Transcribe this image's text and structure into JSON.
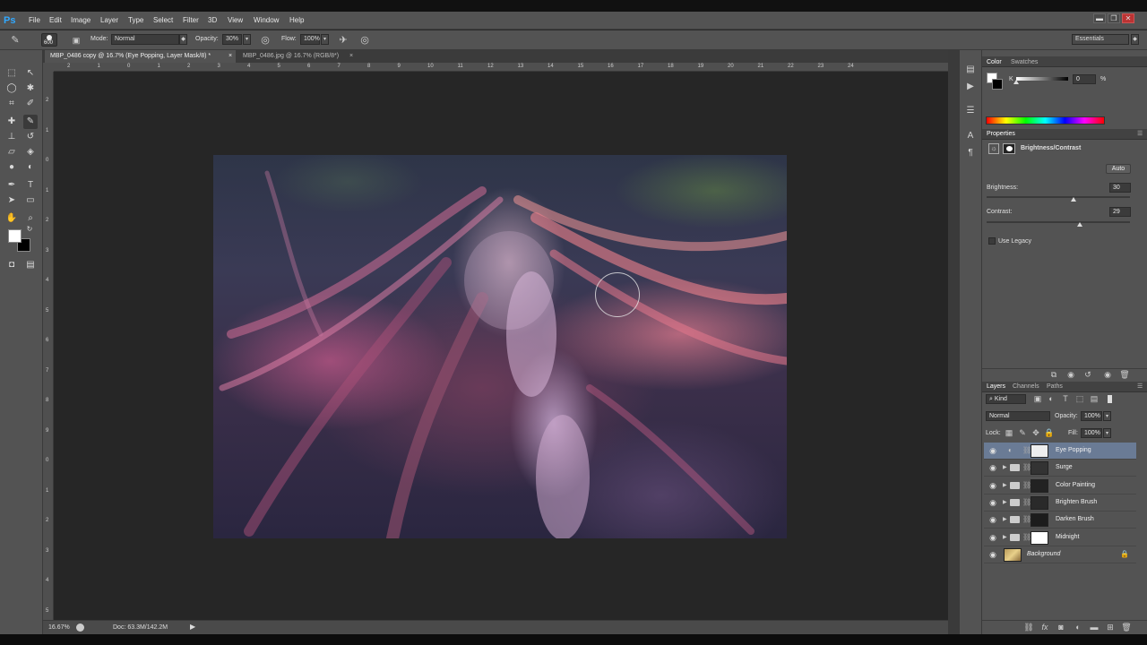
{
  "app": {
    "logo": "Ps"
  },
  "menu": [
    "File",
    "Edit",
    "Image",
    "Layer",
    "Type",
    "Select",
    "Filter",
    "3D",
    "View",
    "Window",
    "Help"
  ],
  "window_controls": {
    "minimize": "▬",
    "restore": "❐",
    "close": "✕"
  },
  "options": {
    "brush_size": "600",
    "mode_label": "Mode:",
    "mode_value": "Normal",
    "opacity_label": "Opacity:",
    "opacity_value": "30%",
    "flow_label": "Flow:",
    "flow_value": "100%",
    "workspace": "Essentials"
  },
  "tabs": [
    {
      "label": "MBP_0486 copy @ 16.7% (Eye Popping, Layer Mask/8) *",
      "close": "×"
    },
    {
      "label": "MBP_0486.jpg @ 16.7% (RGB/8*)",
      "close": "×"
    }
  ],
  "ruler_top": [
    "2",
    "1",
    "0",
    "1",
    "2",
    "3",
    "4",
    "5",
    "6",
    "7",
    "8",
    "9",
    "10",
    "11",
    "12",
    "13",
    "14",
    "15",
    "16",
    "17",
    "18",
    "19",
    "20",
    "21",
    "22",
    "23",
    "24"
  ],
  "ruler_left": [
    "2",
    "1",
    "0",
    "1",
    "2",
    "3",
    "4",
    "5",
    "6",
    "7",
    "8",
    "9",
    "0",
    "1",
    "2",
    "3",
    "4",
    "5"
  ],
  "status": {
    "zoom": "16.67%",
    "doc": "Doc: 63.3M/142.2M"
  },
  "color_panel": {
    "tab1": "Color",
    "tab2": "Swatches",
    "channel": "K",
    "value": "0",
    "unit": "%"
  },
  "properties": {
    "title": "Properties",
    "adjustment": "Brightness/Contrast",
    "auto": "Auto",
    "brightness_label": "Brightness:",
    "brightness": "30",
    "contrast_label": "Contrast:",
    "contrast": "29",
    "legacy": "Use Legacy"
  },
  "layers_panel": {
    "tab1": "Layers",
    "tab2": "Channels",
    "tab3": "Paths",
    "kind": "Kind",
    "blend": "Normal",
    "opacity_label": "Opacity:",
    "opacity": "100%",
    "lock_label": "Lock:",
    "fill_label": "Fill:",
    "fill": "100%"
  },
  "layers": [
    {
      "name": "Eye Popping",
      "selected": true,
      "group": false
    },
    {
      "name": "Surge",
      "selected": false,
      "group": true
    },
    {
      "name": "Color Painting",
      "selected": false,
      "group": true
    },
    {
      "name": "Brighten Brush",
      "selected": false,
      "group": true
    },
    {
      "name": "Darken Brush",
      "selected": false,
      "group": true
    },
    {
      "name": "Midnight",
      "selected": false,
      "group": true
    },
    {
      "name": "Background",
      "selected": false,
      "group": false
    }
  ],
  "colors": {
    "accent": "#31a8ff",
    "selected_layer": "#6a7b95",
    "panel": "#535353"
  }
}
